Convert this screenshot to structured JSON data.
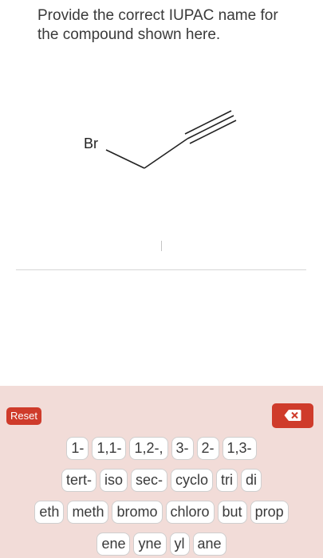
{
  "question": {
    "text": "Provide the correct IUPAC name for the compound shown here."
  },
  "molecule": {
    "atom_label": "Br"
  },
  "keyboard": {
    "reset_label": "Reset",
    "backspace_icon": "backspace-icon",
    "accent_color": "#cf3b2b",
    "background_color": "#f2dcd8",
    "rows": [
      [
        "1-",
        "1,1-",
        "1,2-,",
        "3-",
        "2-",
        "1,3-"
      ],
      [
        "tert-",
        "iso",
        "sec-",
        "cyclo",
        "tri",
        "di"
      ],
      [
        "eth",
        "meth",
        "bromo",
        "chloro",
        "but",
        "prop"
      ],
      [
        "ene",
        "yne",
        "yl",
        "ane"
      ]
    ]
  }
}
